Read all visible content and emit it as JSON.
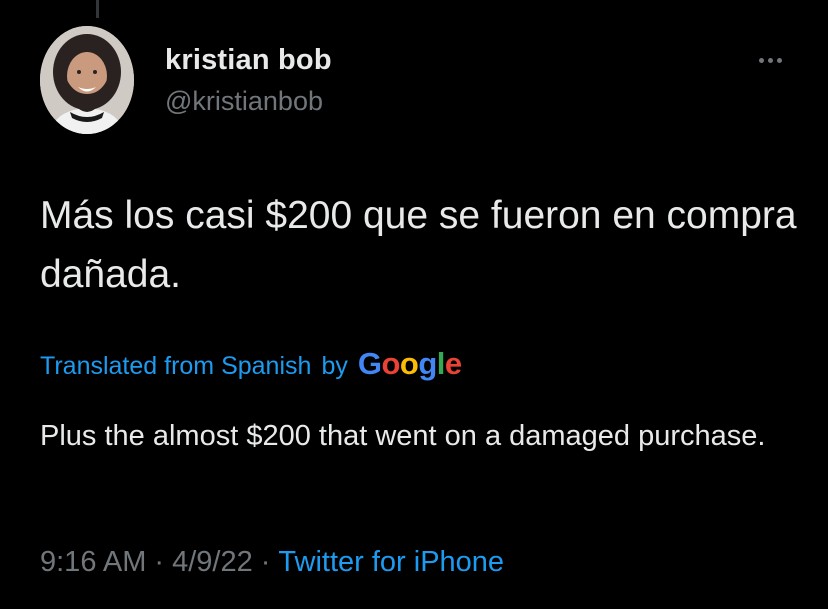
{
  "tweet": {
    "author": {
      "display_name": "kristian bob",
      "handle": "@kristianbob",
      "avatar_icon": "profile-photo-icon"
    },
    "more_icon": "more-options-icon",
    "text": "Más los casi $200 que se fueron en compra dañada.",
    "translation": {
      "label": "Translated from Spanish",
      "by": "by",
      "provider": "Google",
      "provider_letters": [
        "G",
        "o",
        "o",
        "g",
        "l",
        "e"
      ],
      "provider_colors": [
        "#4285F4",
        "#EA4335",
        "#FBBC05",
        "#4285F4",
        "#34A853",
        "#EA4335"
      ],
      "text": "Plus the almost $200 that went on a damaged purchase."
    },
    "meta": {
      "time": "9:16 AM",
      "separator": "·",
      "date": "4/9/22",
      "source": "Twitter for iPhone"
    }
  },
  "colors": {
    "background": "#000000",
    "primary_text": "#e7e9ea",
    "secondary_text": "#71767b",
    "link": "#1d9bf0"
  }
}
